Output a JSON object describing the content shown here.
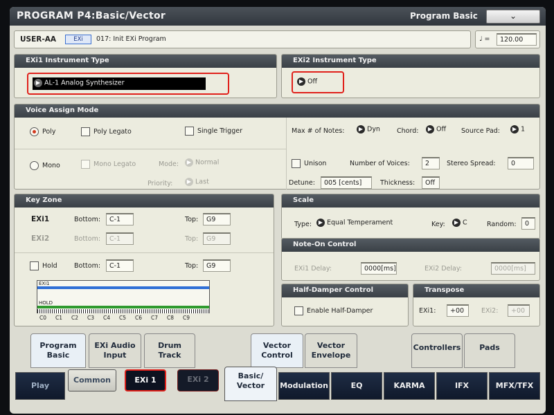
{
  "title": "PROGRAM P4:Basic/Vector",
  "page_menu": {
    "label": "Program Basic",
    "chevron": "chevron-down-icon"
  },
  "header": {
    "bank": "USER-AA",
    "type_badge": "EXi",
    "program_name": "017: Init EXi Program",
    "tempo_symbol": "♩ =",
    "tempo": "120.00"
  },
  "exi1_type": {
    "title": "EXi1 Instrument Type",
    "value": "AL-1 Analog Synthesizer"
  },
  "exi2_type": {
    "title": "EXi2 Instrument Type",
    "value": "Off"
  },
  "voice_assign": {
    "title": "Voice Assign Mode",
    "poly": "Poly",
    "poly_legato": "Poly Legato",
    "single_trigger": "Single Trigger",
    "max_notes_label": "Max # of Notes:",
    "max_notes_value": "Dyn",
    "chord_label": "Chord:",
    "chord_value": "Off",
    "source_pad_label": "Source Pad:",
    "source_pad_value": "1",
    "mono": "Mono",
    "mono_legato": "Mono Legato",
    "mode_label": "Mode:",
    "mode_value": "Normal",
    "priority_label": "Priority:",
    "priority_value": "Last",
    "unison": "Unison",
    "voices_label": "Number of Voices:",
    "voices_value": "2",
    "spread_label": "Stereo Spread:",
    "spread_value": "0",
    "detune_label": "Detune:",
    "detune_value": "005 [cents]",
    "thickness_label": "Thickness:",
    "thickness_value": "Off"
  },
  "key_zone": {
    "title": "Key Zone",
    "exi1_label": "EXi1",
    "exi2_label": "EXi2",
    "hold_label": "Hold",
    "bottom_label": "Bottom:",
    "top_label": "Top:",
    "exi1_bottom": "C-1",
    "exi1_top": "G9",
    "exi2_bottom": "C-1",
    "exi2_top": "G9",
    "hold_bottom": "C-1",
    "hold_top": "G9",
    "graph_exi1": "EXi1",
    "graph_hold": "HOLD",
    "keys": [
      "C0",
      "C1",
      "C2",
      "C3",
      "C4",
      "C5",
      "C6",
      "C7",
      "C8",
      "C9"
    ],
    "exi1_bar_color": "#2f6fd6",
    "hold_bar_color": "#2e9a2e"
  },
  "scale": {
    "title": "Scale",
    "type_label": "Type:",
    "type_value": "Equal Temperament",
    "key_label": "Key:",
    "key_value": "C",
    "random_label": "Random:",
    "random_value": "0"
  },
  "note_on": {
    "title": "Note-On Control",
    "exi1_label": "EXi1 Delay:",
    "exi1_value": "0000[ms]",
    "exi2_label": "EXi2 Delay:",
    "exi2_value": "0000[ms]"
  },
  "half_damper": {
    "title": "Half-Damper Control",
    "enable_label": "Enable Half-Damper"
  },
  "transpose": {
    "title": "Transpose",
    "exi1_label": "EXi1:",
    "exi1_value": "+00",
    "exi2_label": "EXi2:",
    "exi2_value": "+00"
  },
  "page_tabs": [
    "Program\nBasic",
    "EXi Audio\nInput",
    "Drum\nTrack",
    "Vector\nControl",
    "Vector\nEnvelope",
    "Controllers",
    "Pads"
  ],
  "main_tabs": [
    "Play",
    "Common",
    "EXi 1",
    "EXi 2",
    "Basic/\nVector",
    "Modulation",
    "EQ",
    "KARMA",
    "IFX",
    "MFX/TFX"
  ],
  "highlight_color": "#e0201a"
}
